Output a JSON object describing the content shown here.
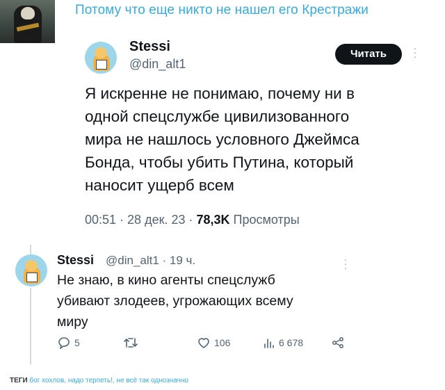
{
  "post": {
    "caption": "Потому что еще никто не нашел его Крестражи"
  },
  "tweet": {
    "author_name": "Stessi",
    "author_handle": "@din_alt1",
    "follow_label": "Читать",
    "text": "Я искренне не понимаю, почему ни в\nодной спецслужбе цивилизованного\nмира не нашлось условного Джеймса\nБонда, чтобы убить Путина, который\nнаносит ущерб всем",
    "time": "00:51 · 28 дек. 23 · ",
    "views_count": "78,3K",
    "views_label": " Просмотры"
  },
  "reply": {
    "author_name": "Stessi",
    "author_handle": "@din_alt1 · 19 ч.",
    "text": "Не знаю, в кино агенты спецслужб\nубивают злодеев, угрожающих всему\nмиру",
    "replies_count": "5",
    "retweets_count": "",
    "likes_count": "106",
    "views_count": "6 678"
  },
  "tags": {
    "label": "ТЕГИ",
    "items": [
      "бог хохлов,",
      "надо терпеть!,",
      "не всё так однозначно"
    ]
  },
  "icons": {
    "reply": "comment-icon",
    "retweet": "retweet-icon",
    "like": "heart-icon",
    "views": "views-bar-icon",
    "share": "share-icon",
    "more": "more-dots-icon"
  },
  "colors": {
    "caption": "#3aa9d6",
    "follow_button": "#0f1419",
    "secondary_text": "#536471",
    "avatar_bg": "#9dd6ea"
  }
}
